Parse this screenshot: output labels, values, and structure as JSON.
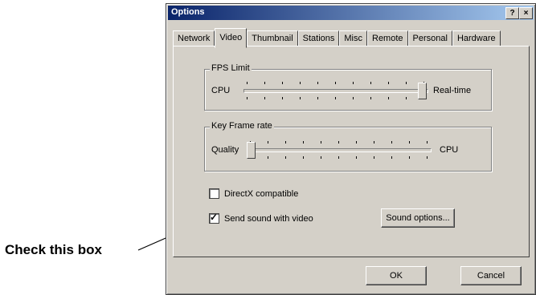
{
  "window": {
    "title": "Options",
    "help_label": "?",
    "close_label": "×"
  },
  "tabs": [
    {
      "label": "Network",
      "active": false
    },
    {
      "label": "Video",
      "active": true
    },
    {
      "label": "Thumbnail",
      "active": false
    },
    {
      "label": "Stations",
      "active": false
    },
    {
      "label": "Misc",
      "active": false
    },
    {
      "label": "Remote",
      "active": false
    },
    {
      "label": "Personal",
      "active": false
    },
    {
      "label": "Hardware",
      "active": false
    }
  ],
  "fps_group": {
    "title": "FPS Limit",
    "left_label": "CPU",
    "right_label": "Real-time",
    "level": 1.0
  },
  "keyframe_group": {
    "title": "Key Frame rate",
    "left_label": "Quality",
    "right_label": "CPU",
    "level": 0.0
  },
  "directx": {
    "label": "DirectX compatible",
    "checked": false
  },
  "send_sound": {
    "label": "Send sound with video",
    "checked": true
  },
  "buttons": {
    "sound_options": "Sound options...",
    "ok": "OK",
    "cancel": "Cancel"
  },
  "annotation": {
    "text": "Check this box"
  }
}
